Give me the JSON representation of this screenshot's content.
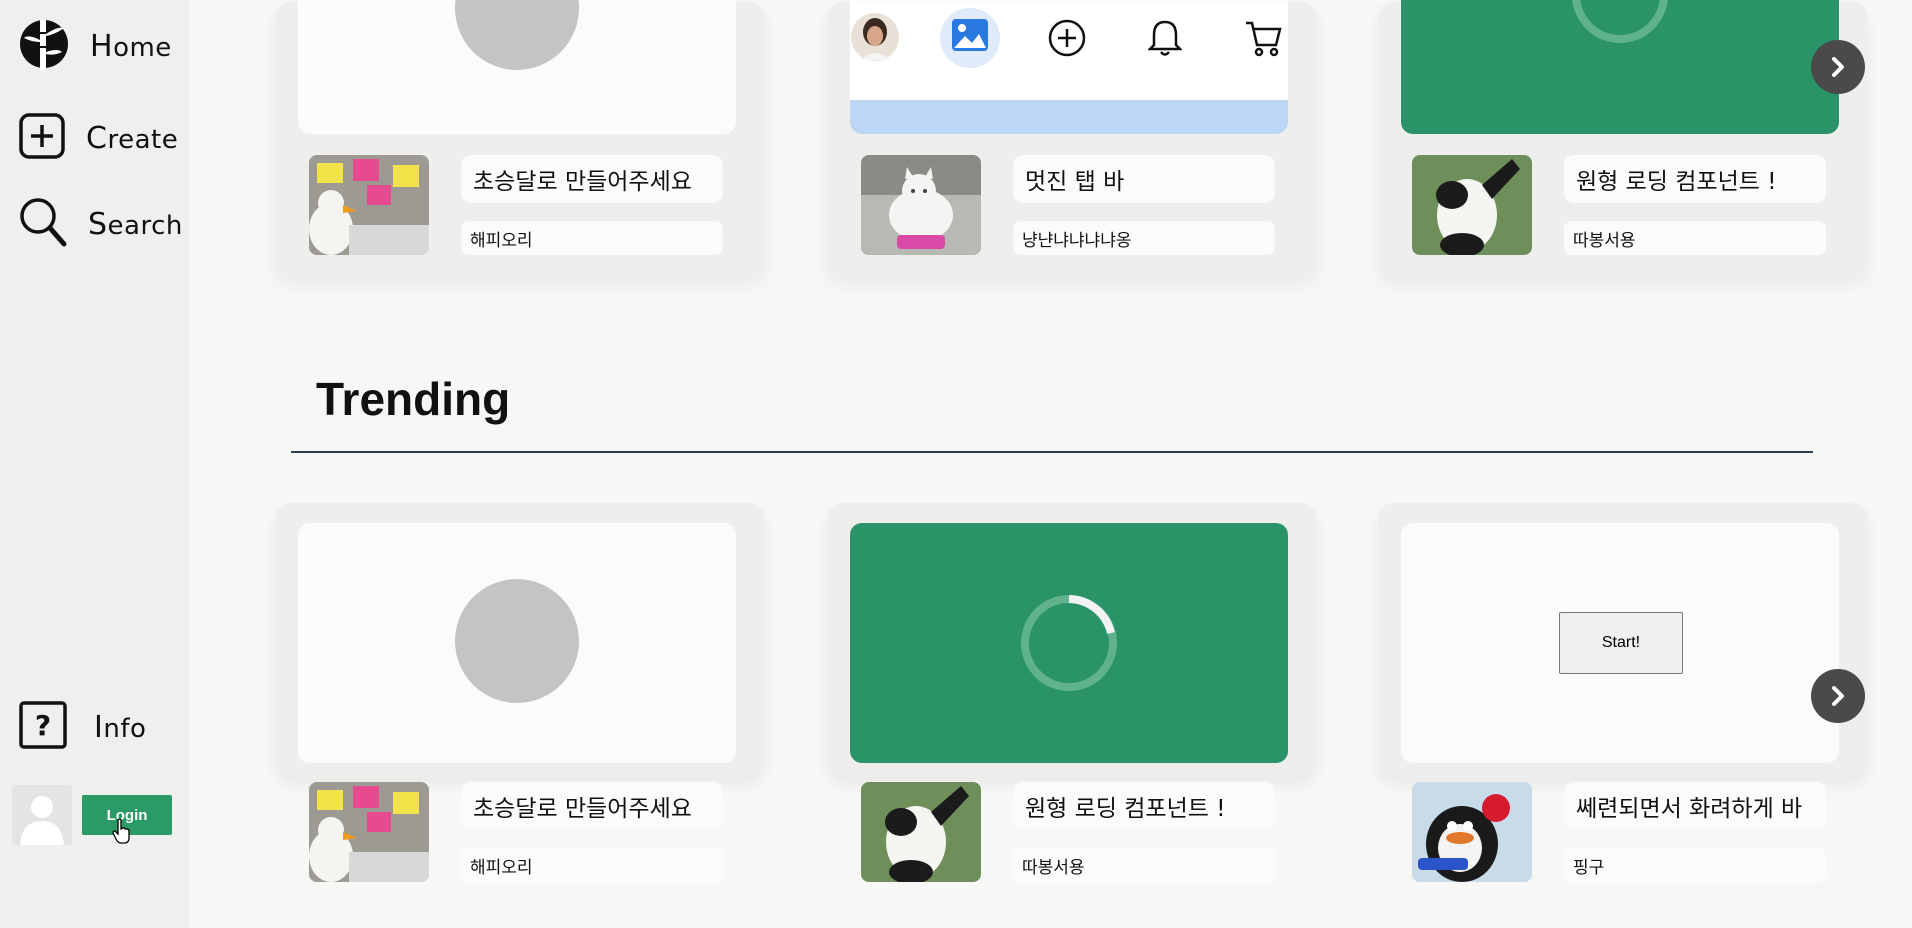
{
  "sidebar": {
    "home_label": "Home",
    "create_label": "Create",
    "search_label": "Search",
    "info_label": "Info",
    "login_label": "Login"
  },
  "colors": {
    "accent_green": "#2a9468",
    "login_green": "#2a9a66",
    "tabbar_blue": "#bcd7f5"
  },
  "top_row": [
    {
      "title": "초승달로 만들어주세요",
      "author": "해피오리",
      "preview": "grey-circle",
      "thumb": "duck"
    },
    {
      "title": "멋진 탭 바",
      "author": "냥냔냐냐냐냐옹",
      "preview": "tab-bar",
      "thumb": "cat"
    },
    {
      "title": "원형 로딩 컴포넌트 !",
      "author": "따봉서용",
      "preview": "spinner",
      "thumb": "panda"
    }
  ],
  "section": {
    "title": "Trending"
  },
  "trending_row": [
    {
      "title": "초승달로 만들어주세요",
      "author": "해피오리",
      "preview": "grey-circle",
      "thumb": "duck"
    },
    {
      "title": "원형 로딩 컴포넌트 !",
      "author": "따봉서용",
      "preview": "spinner",
      "thumb": "panda"
    },
    {
      "title": "쎄련되면서 화려하게 바",
      "author": "핑구",
      "preview": "start-button",
      "thumb": "pingu",
      "button_label": "Start!"
    }
  ],
  "icons": {
    "logo": "bamboo-logo-icon",
    "create": "plus-square-icon",
    "search": "magnifier-icon",
    "info": "question-square-icon",
    "next": "chevron-right-icon"
  }
}
